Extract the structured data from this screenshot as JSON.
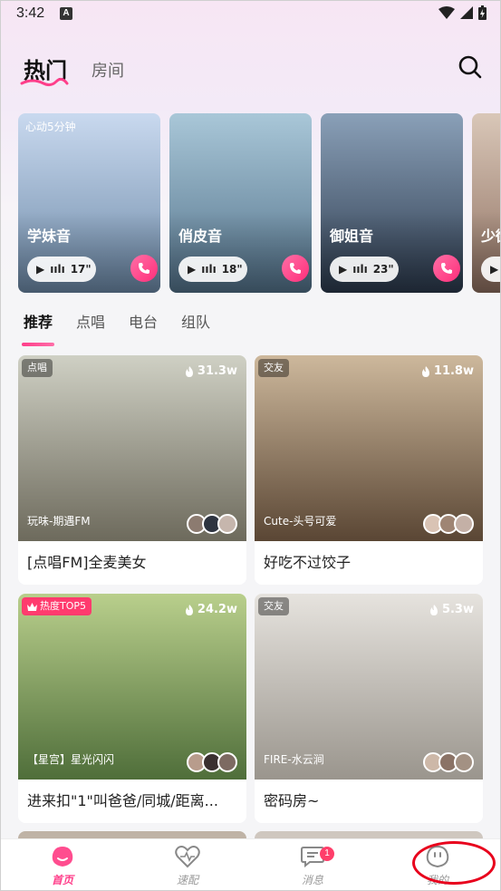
{
  "status_bar": {
    "time": "3:42",
    "notif_icon_letter": "A"
  },
  "header": {
    "tab_hot": "热门",
    "tab_room": "房间"
  },
  "featured": [
    {
      "badge": "心动5分钟",
      "name": "学妹音",
      "duration": "17\"",
      "colors": [
        "#c9d9ef",
        "#6d8aa8"
      ]
    },
    {
      "badge": "",
      "name": "俏皮音",
      "duration": "18\"",
      "colors": [
        "#a9c7d8",
        "#53728a"
      ]
    },
    {
      "badge": "",
      "name": "御姐音",
      "duration": "23\"",
      "colors": [
        "#8aa0b8",
        "#2c3a4d"
      ]
    },
    {
      "badge": "",
      "name": "少御",
      "duration": "",
      "colors": [
        "#d9c7b8",
        "#8e6f60"
      ]
    }
  ],
  "sub_tabs": [
    "推荐",
    "点唱",
    "电台",
    "组队"
  ],
  "rooms": [
    {
      "tag": "点唱",
      "tag_hot": false,
      "heat": "31.3w",
      "sub": "玩味-期遇FM",
      "title": "[点唱FM]全麦美女",
      "colors": [
        "#cfd0c4",
        "#6d6a5c"
      ]
    },
    {
      "tag": "交友",
      "tag_hot": false,
      "heat": "11.8w",
      "sub": "Cute-头号可爱",
      "title": "好吃不过饺子",
      "colors": [
        "#cdb89c",
        "#5a4634"
      ]
    },
    {
      "tag": "热度TOP5",
      "tag_hot": true,
      "heat": "24.2w",
      "sub": "【星宫】星光闪闪",
      "title": "进来扣\"1\"叫爸爸/同城/距离...",
      "colors": [
        "#b9cf8c",
        "#4f6e3a"
      ]
    },
    {
      "tag": "交友",
      "tag_hot": false,
      "heat": "5.3w",
      "sub": "FIRE-水云涧",
      "title": "密码房~",
      "colors": [
        "#e6e3de",
        "#9a958d"
      ]
    }
  ],
  "bottom_nav": [
    {
      "label": "首页",
      "active": true
    },
    {
      "label": "速配",
      "active": false
    },
    {
      "label": "消息",
      "active": false,
      "badge": "1"
    },
    {
      "label": "我的",
      "active": false
    }
  ],
  "accent_color": "#ff3e8a"
}
